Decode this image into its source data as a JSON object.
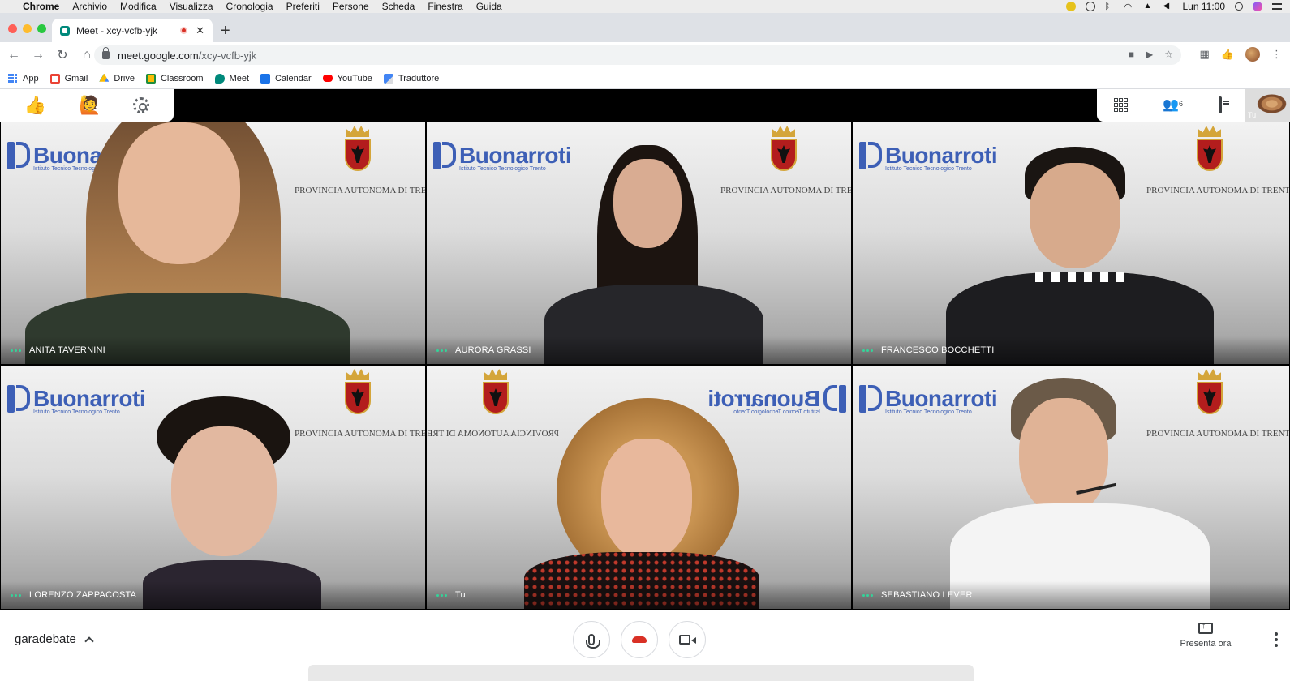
{
  "menubar": {
    "apple": "",
    "items": [
      "Chrome",
      "Archivio",
      "Modifica",
      "Visualizza",
      "Cronologia",
      "Preferiti",
      "Persone",
      "Scheda",
      "Finestra",
      "Guida"
    ],
    "clock": "Lun 11:00"
  },
  "tab": {
    "title": "Meet - xcy-vcfb-yjk",
    "close": "✕",
    "new_tab": "+"
  },
  "toolbar": {
    "url_host": "meet.google.com",
    "url_path": "/xcy-vcfb-yjk"
  },
  "bookmarks": [
    {
      "label": "App",
      "icon": "apps-grid-icon",
      "color": "#4285f4"
    },
    {
      "label": "Gmail",
      "icon": "gmail-icon",
      "color": "#ea4335"
    },
    {
      "label": "Drive",
      "icon": "drive-icon",
      "color": "#fbbc04"
    },
    {
      "label": "Classroom",
      "icon": "classroom-icon",
      "color": "#1e8e3e"
    },
    {
      "label": "Meet",
      "icon": "meet-icon",
      "color": "#00897b"
    },
    {
      "label": "Calendar",
      "icon": "calendar-icon",
      "color": "#1a73e8"
    },
    {
      "label": "YouTube",
      "icon": "youtube-icon",
      "color": "#ff0000"
    },
    {
      "label": "Traduttore",
      "icon": "translate-icon",
      "color": "#4285f4"
    }
  ],
  "meet_top": {
    "people_count": "6",
    "self_label": "Tu"
  },
  "brand": {
    "school_name": "Buonarroti",
    "school_sub": "Istituto Tecnico Tecnologico Trento",
    "province": "PROVINCIA AUTONOMA DI TRENTO",
    "color": "#3d5fb6"
  },
  "participants": [
    {
      "name": "ANITA TAVERNINI"
    },
    {
      "name": "AURORA GRASSI"
    },
    {
      "name": "FRANCESCO BOCCHETTI"
    },
    {
      "name": "LORENZO ZAPPACOSTA"
    },
    {
      "name": "Tu"
    },
    {
      "name": "SEBASTIANO LEVER"
    }
  ],
  "bottom": {
    "meeting_name": "garadebate",
    "present_label": "Presenta ora"
  },
  "colors": {
    "hangup": "#d93025",
    "active_dots": "#34d399"
  }
}
